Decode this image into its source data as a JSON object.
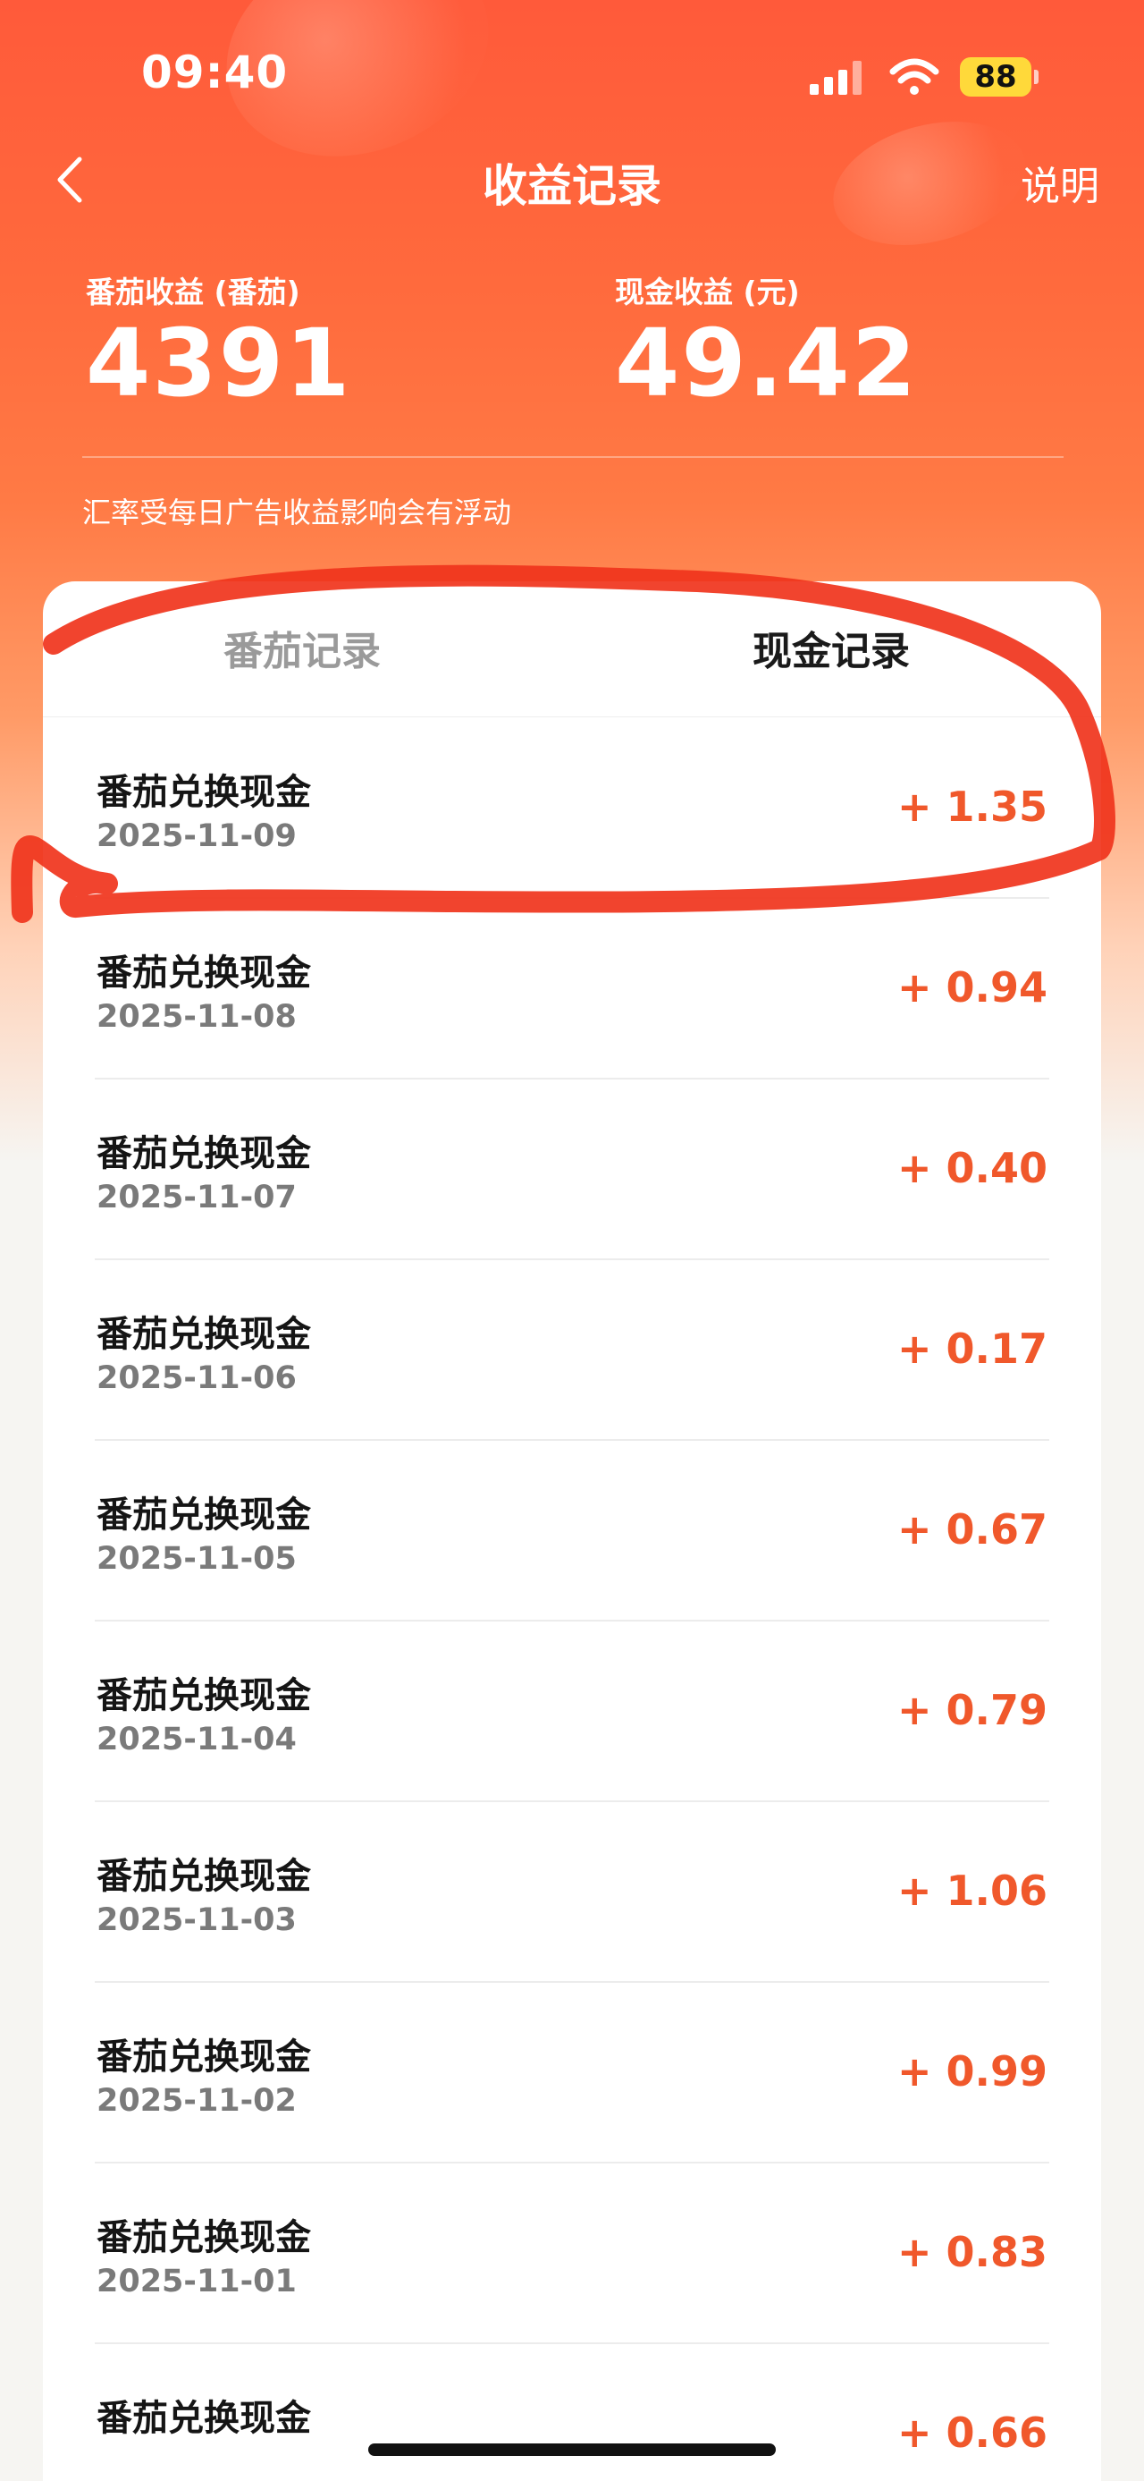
{
  "status_bar": {
    "time": "09:40",
    "battery_level": "88",
    "icons": [
      "signal-icon",
      "wifi-icon",
      "battery-icon"
    ]
  },
  "nav": {
    "title": "收益记录",
    "help": "说明",
    "back_icon": "chevron-left-icon"
  },
  "summary": {
    "tomato_label": "番茄收益 (番茄)",
    "tomato_value": "4391",
    "cash_label": "现金收益 (元)",
    "cash_value": "49.42",
    "note": "汇率受每日广告收益影响会有浮动"
  },
  "tabs": {
    "tomato": "番茄记录",
    "cash": "现金记录",
    "active": "cash"
  },
  "records": [
    {
      "title": "番茄兑换现金",
      "date": "2025-11-09",
      "amount": "+ 1.35"
    },
    {
      "title": "番茄兑换现金",
      "date": "2025-11-08",
      "amount": "+ 0.94"
    },
    {
      "title": "番茄兑换现金",
      "date": "2025-11-07",
      "amount": "+ 0.40"
    },
    {
      "title": "番茄兑换现金",
      "date": "2025-11-06",
      "amount": "+ 0.17"
    },
    {
      "title": "番茄兑换现金",
      "date": "2025-11-05",
      "amount": "+ 0.67"
    },
    {
      "title": "番茄兑换现金",
      "date": "2025-11-04",
      "amount": "+ 0.79"
    },
    {
      "title": "番茄兑换现金",
      "date": "2025-11-03",
      "amount": "+ 1.06"
    },
    {
      "title": "番茄兑换现金",
      "date": "2025-11-02",
      "amount": "+ 0.99"
    },
    {
      "title": "番茄兑换现金",
      "date": "2025-11-01",
      "amount": "+ 0.83"
    },
    {
      "title": "番茄兑换现金",
      "date": "",
      "amount": "+ 0.66"
    }
  ],
  "colors": {
    "header_gradient_top": "#ff5a3a",
    "amount": "#f0582b",
    "battery": "#ffd93a",
    "annotation": "#f0341c"
  }
}
